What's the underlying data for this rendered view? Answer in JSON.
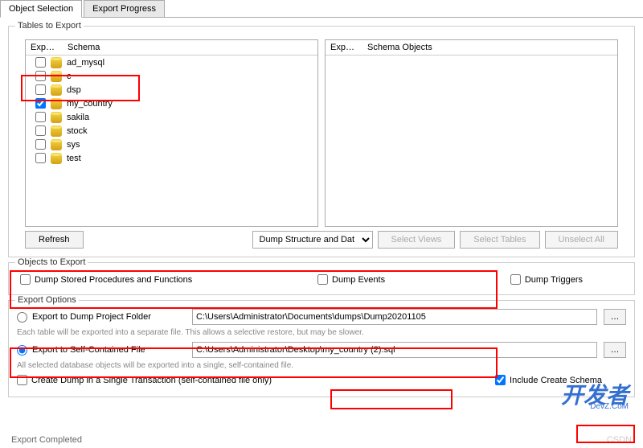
{
  "tabs": {
    "object_selection": "Object Selection",
    "export_progress": "Export Progress"
  },
  "tables_to_export": {
    "label": "Tables to Export",
    "left_pane": {
      "col_exp": "Exp…",
      "col_schema": "Schema",
      "rows": [
        {
          "checked": false,
          "name": "ad_mysql"
        },
        {
          "checked": false,
          "name": "c"
        },
        {
          "checked": false,
          "name": "dsp"
        },
        {
          "checked": true,
          "name": "my_country"
        },
        {
          "checked": false,
          "name": "sakila"
        },
        {
          "checked": false,
          "name": "stock"
        },
        {
          "checked": false,
          "name": "sys"
        },
        {
          "checked": false,
          "name": "test"
        }
      ]
    },
    "right_pane": {
      "col_exp": "Exp…",
      "col_schema": "Schema Objects"
    },
    "refresh_btn": "Refresh",
    "dump_select": "Dump Structure and Dat",
    "select_views_btn": "Select Views",
    "select_tables_btn": "Select Tables",
    "unselect_all_btn": "Unselect All"
  },
  "objects_to_export": {
    "label": "Objects to Export",
    "dump_procedures": "Dump Stored Procedures and Functions",
    "dump_events": "Dump Events",
    "dump_triggers": "Dump Triggers"
  },
  "export_options": {
    "label": "Export Options",
    "dump_folder_label": "Export to Dump Project Folder",
    "dump_folder_path": "C:\\Users\\Administrator\\Documents\\dumps\\Dump20201105",
    "dump_folder_help": "Each table will be exported into a separate file. This allows a selective restore, but may be slower.",
    "self_contained_label": "Export to Self-Contained File",
    "self_contained_path": "C:\\Users\\Administrator\\Desktop\\my_country (2).sql",
    "self_contained_help": "All selected database objects will be exported into a single, self-contained file.",
    "single_transaction": "Create Dump in a Single Transaction (self-contained file only)",
    "include_create_schema": "Include Create Schema",
    "browse_btn": "…"
  },
  "footer": {
    "status": "Export Completed",
    "right": "CSDN"
  },
  "watermark": {
    "main": "开发者",
    "sub": "DevZ.CoM"
  }
}
